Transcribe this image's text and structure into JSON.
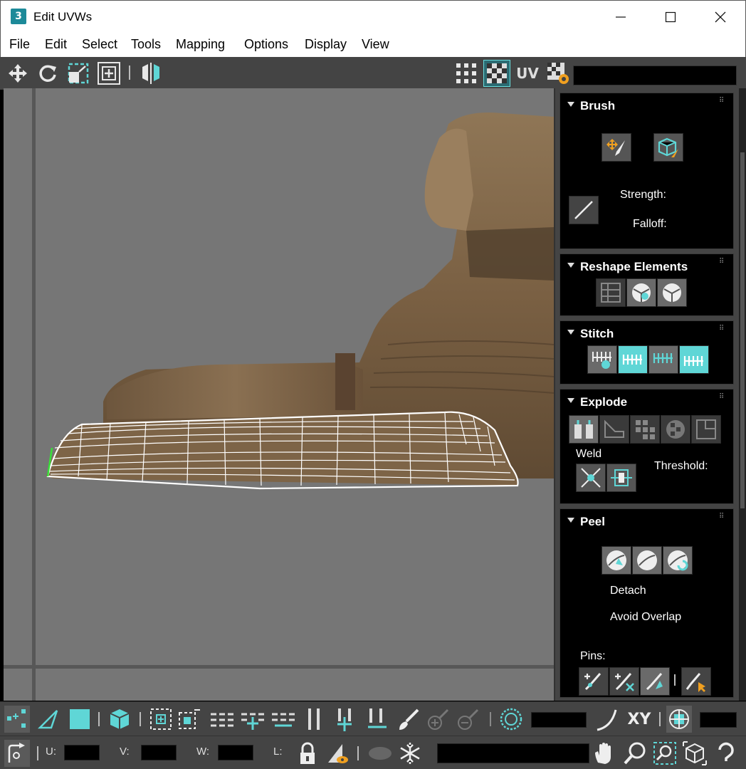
{
  "window": {
    "title": "Edit UVWs",
    "logo": "3",
    "minimize_icon": "minimize-icon",
    "maximize_icon": "maximize-icon",
    "close_icon": "close-icon"
  },
  "menu": [
    "File",
    "Edit",
    "Select",
    "Tools",
    "Mapping",
    "Options",
    "Display",
    "View"
  ],
  "toolbar": {
    "uv_label": "UV",
    "texture_dropdown_value": ""
  },
  "panel": {
    "brush": {
      "title": "Brush",
      "strength_label": "Strength:",
      "falloff_label": "Falloff:"
    },
    "reshape": {
      "title": "Reshape Elements"
    },
    "stitch": {
      "title": "Stitch"
    },
    "explode": {
      "title": "Explode",
      "weld_label": "Weld",
      "threshold_label": "Threshold:"
    },
    "peel": {
      "title": "Peel",
      "detach_label": "Detach",
      "avoid_overlap_label": "Avoid Overlap",
      "pins_label": "Pins:"
    }
  },
  "bottom": {
    "xy_label": "XY",
    "u_label": "U:",
    "v_label": "V:",
    "w_label": "W:",
    "l_label": "L:"
  },
  "colors": {
    "accent": "#5fd6d6",
    "viewport_bg": "#767676",
    "panel_bg": "#444444"
  }
}
